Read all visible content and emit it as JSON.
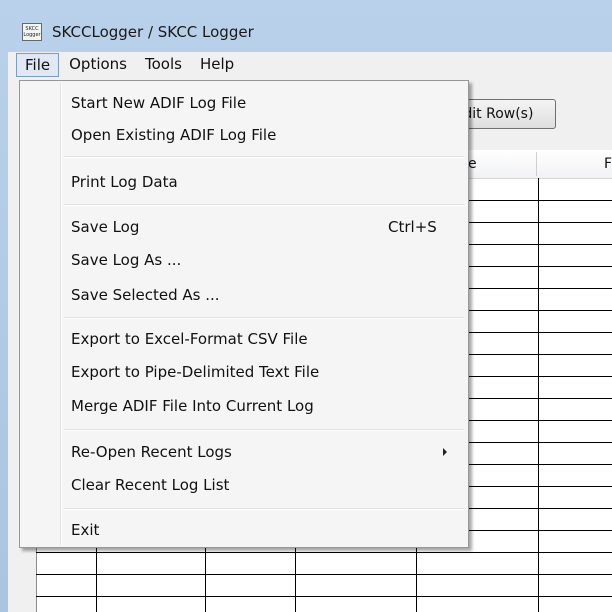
{
  "window": {
    "title": "SKCCLogger / SKCC Logger",
    "icon_text": "SKCC Logger",
    "icon": "app-logo-icon"
  },
  "menubar": {
    "items": [
      "File",
      "Options",
      "Tools",
      "Help"
    ],
    "active": "File"
  },
  "toolbar": {
    "edit_rows_label": "Edit Row(s)"
  },
  "grid": {
    "headers": [
      "e",
      "F"
    ]
  },
  "file_menu": {
    "items": [
      {
        "label": "Start New ADIF Log File"
      },
      {
        "label": "Open Existing ADIF Log File"
      },
      {
        "label": "Print Log Data"
      },
      {
        "label": "Save Log",
        "shortcut": "Ctrl+S"
      },
      {
        "label": "Save Log As ..."
      },
      {
        "label": "Save Selected As ..."
      },
      {
        "label": "Export to Excel-Format CSV File"
      },
      {
        "label": "Export to Pipe-Delimited Text File"
      },
      {
        "label": "Merge ADIF File Into Current Log"
      },
      {
        "label": "Re-Open Recent Logs",
        "submenu": true
      },
      {
        "label": "Clear Recent Log List"
      },
      {
        "label": "Exit"
      }
    ]
  }
}
